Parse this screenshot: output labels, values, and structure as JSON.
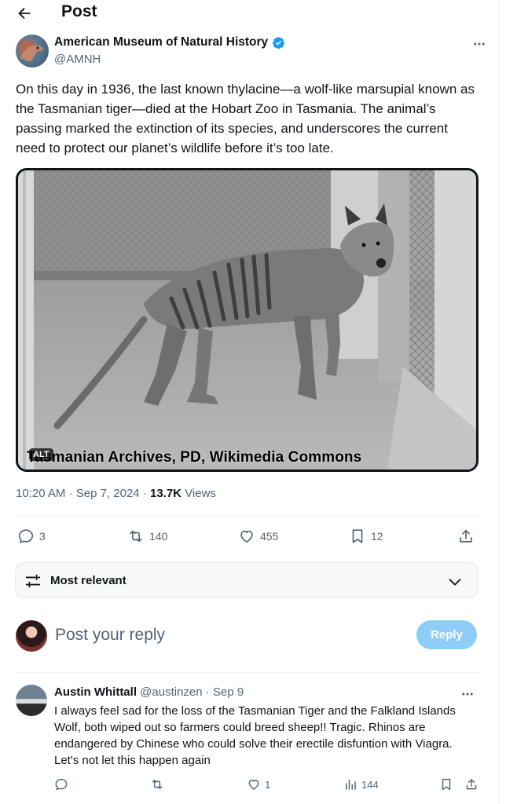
{
  "header": {
    "title": "Post",
    "back_icon": "arrow-left-icon"
  },
  "post": {
    "author_name": "American Museum of Natural History",
    "author_handle": "@AMNH",
    "verified": true,
    "verified_color": "#1d9bf0",
    "text": "On this day in 1936, the last known thylacine—a wolf-like marsupial known as the Tasmanian tiger—died at the Hobart Zoo in Tasmania. The animal’s passing marked the extinction of its species, and underscores the current need to protect our planet’s wildlife before it’s too late.",
    "media": {
      "alt_badge": "ALT",
      "caption": "Tasmanian Archives, PD, Wikimedia Commons"
    },
    "time": "10:20 AM",
    "date": "Sep 7, 2024",
    "views_count": "13.7K",
    "views_label": "Views",
    "stats": {
      "replies": "3",
      "reposts": "140",
      "likes": "455",
      "bookmarks": "12"
    }
  },
  "sort": {
    "label": "Most relevant"
  },
  "reply_composer": {
    "placeholder": "Post your reply",
    "button_label": "Reply",
    "button_color": "#8ecdf7"
  },
  "comments": [
    {
      "name": "Austin Whittall",
      "handle": "@austinzen",
      "separator": "·",
      "date": "Sep 9",
      "text": "I always feel sad for the loss of the Tasmanian Tiger and the Falkland Islands Wolf, both wiped out so farmers could breed sheep!! Tragic. Rhinos are endangered by Chinese who could solve their erectile disfuntion with Viagra. Let's not let this happen again",
      "likes": "1",
      "views": "144"
    }
  ],
  "colors": {
    "text": "#0f1419",
    "secondary": "#536471",
    "accent": "#1d9bf0",
    "border": "#eff3f4"
  }
}
